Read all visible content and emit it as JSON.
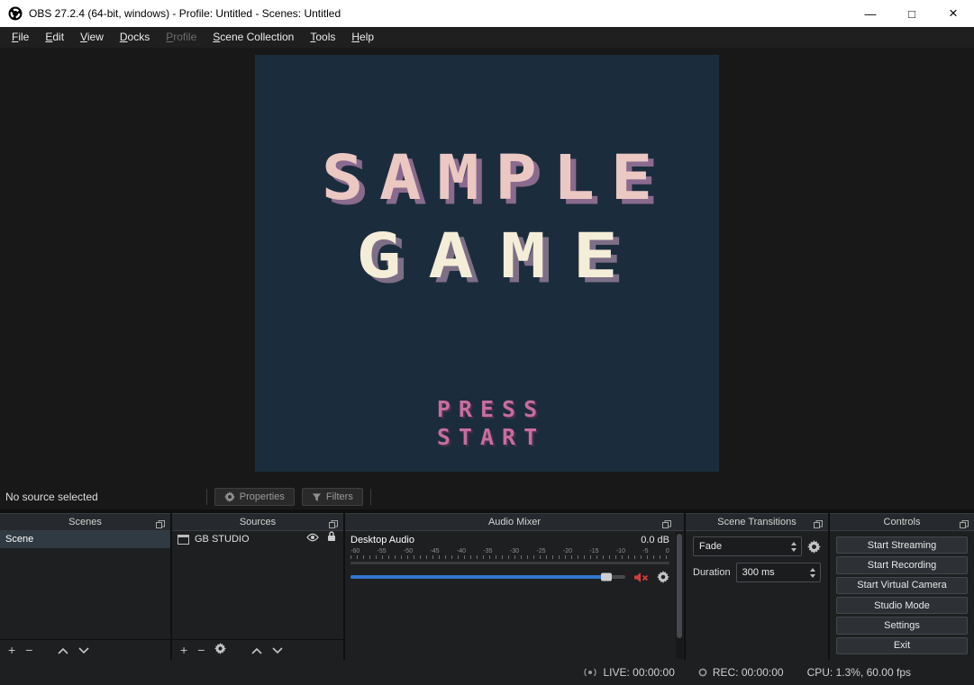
{
  "colors": {
    "accent_blue": "#3276cd",
    "mute_red": "#cf4040",
    "game_bg": "#1b2d3d",
    "game_title_pink": "#ecc8c2",
    "game_title_cream": "#f4eed8",
    "game_press_pink": "#c76d9f",
    "titlebar_bg": "#ffffff",
    "panel_bg": "#1d1f21"
  },
  "window": {
    "app_title": "OBS 27.2.4 (64-bit, windows) - Profile: Untitled - Scenes: Untitled",
    "minimize": "—",
    "maximize": "□",
    "close": "×"
  },
  "menu": {
    "items": [
      {
        "label": "File",
        "enabled": true
      },
      {
        "label": "Edit",
        "enabled": true
      },
      {
        "label": "View",
        "enabled": true
      },
      {
        "label": "Docks",
        "enabled": true
      },
      {
        "label": "Profile",
        "enabled": false
      },
      {
        "label": "Scene Collection",
        "enabled": true
      },
      {
        "label": "Tools",
        "enabled": true
      },
      {
        "label": "Help",
        "enabled": true
      }
    ]
  },
  "preview": {
    "title_line1": "SAMPLE",
    "title_line2": "GAME",
    "press_line1": "PRESS",
    "press_line2": "START"
  },
  "source_toolbar": {
    "status": "No source selected",
    "properties": "Properties",
    "filters": "Filters"
  },
  "scenes": {
    "title": "Scenes",
    "items": [
      {
        "name": "Scene",
        "selected": true
      }
    ]
  },
  "sources": {
    "title": "Sources",
    "items": [
      {
        "name": "GB STUDIO",
        "visible": true,
        "locked": true
      }
    ]
  },
  "audio_mixer": {
    "title": "Audio Mixer",
    "channel": {
      "name": "Desktop Audio",
      "level": "0.0 dB",
      "muted": true,
      "volume_percent": 93,
      "ticks": [
        "-60",
        "-55",
        "-50",
        "-45",
        "-40",
        "-35",
        "-30",
        "-25",
        "-20",
        "-15",
        "-10",
        "-5",
        "0"
      ]
    }
  },
  "transitions": {
    "title": "Scene Transitions",
    "selected": "Fade",
    "duration_label": "Duration",
    "duration_value": "300 ms"
  },
  "controls": {
    "title": "Controls",
    "buttons": [
      "Start Streaming",
      "Start Recording",
      "Start Virtual Camera",
      "Studio Mode",
      "Settings",
      "Exit"
    ]
  },
  "status_bar": {
    "live": "LIVE: 00:00:00",
    "rec": "REC: 00:00:00",
    "cpu": "CPU: 1.3%, 60.00 fps"
  },
  "icons": {
    "plus": "+",
    "minus": "−"
  }
}
